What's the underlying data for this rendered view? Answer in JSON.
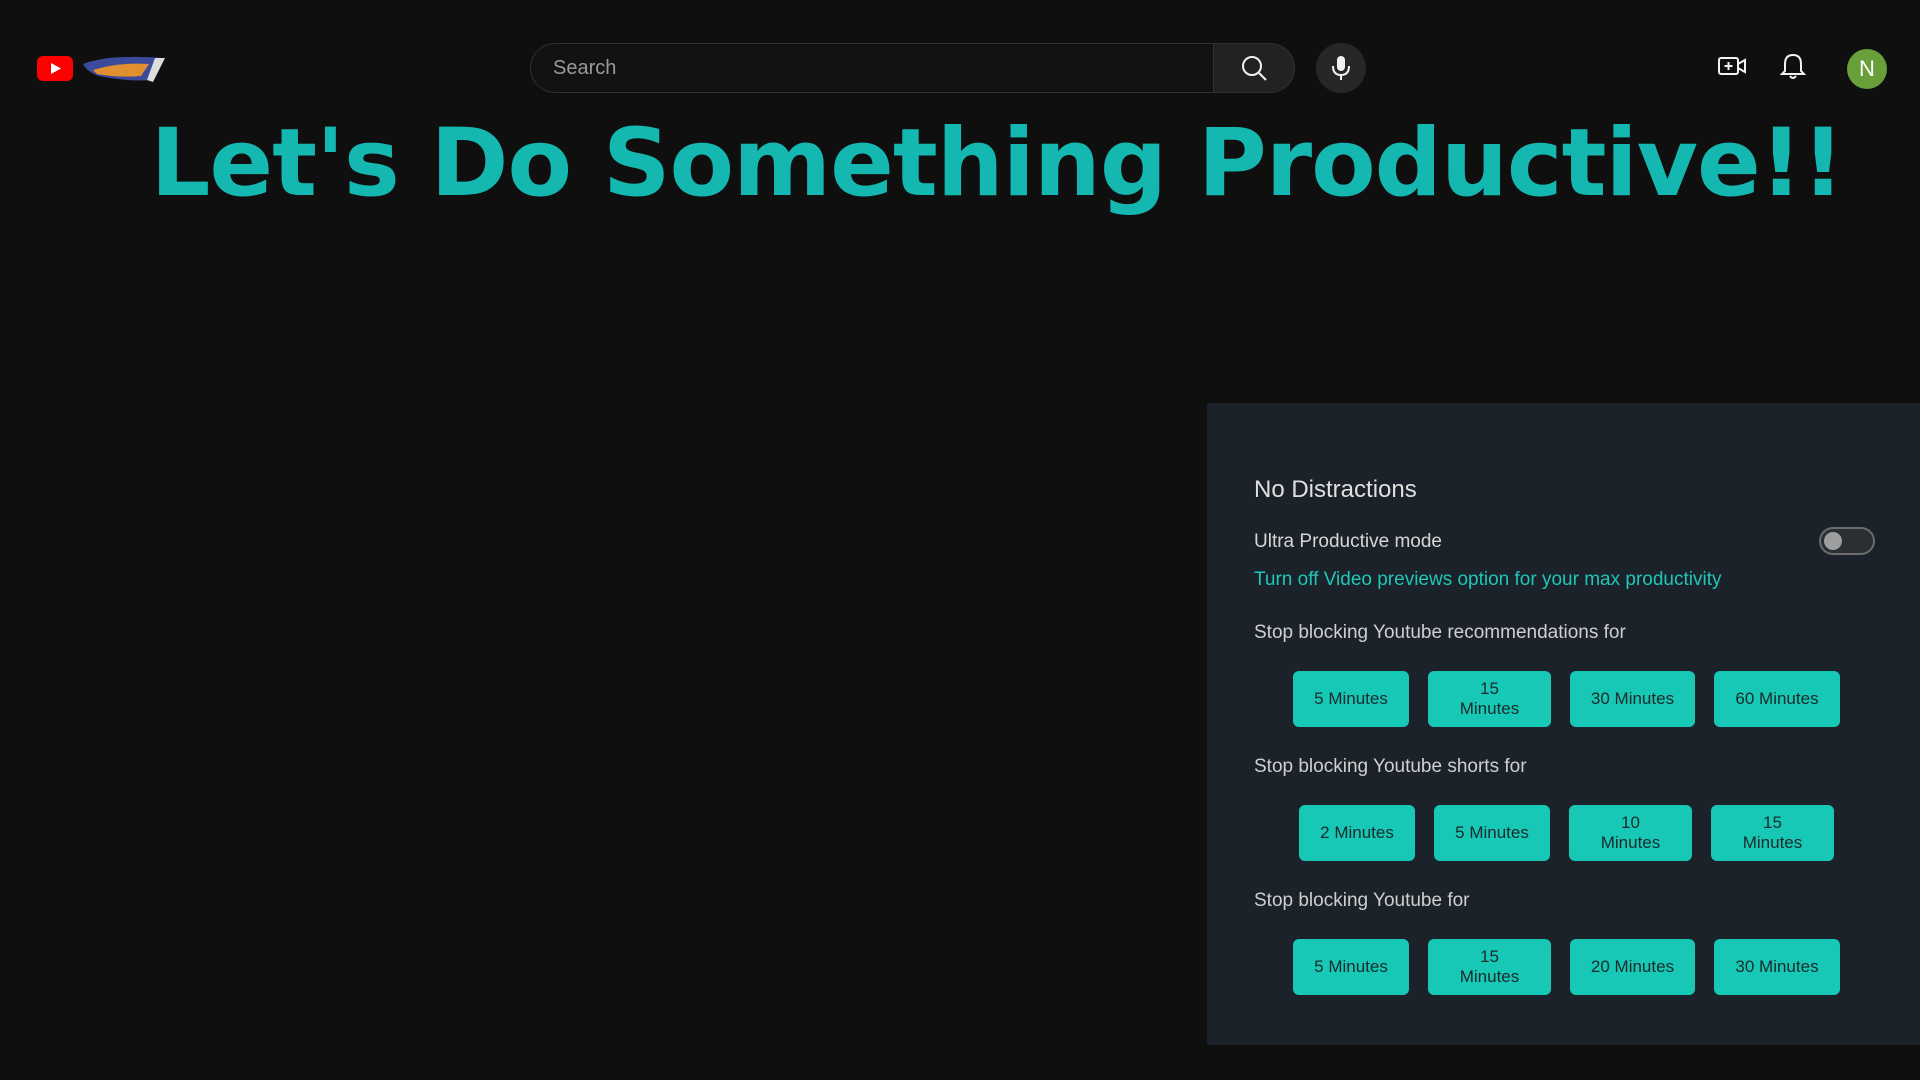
{
  "search": {
    "placeholder": "Search"
  },
  "avatar": {
    "initial": "N",
    "color": "#689f38"
  },
  "headline": "Let's Do Something Productive!!",
  "panel": {
    "title": "No Distractions",
    "ultra_mode": {
      "label": "Ultra Productive mode",
      "enabled": false
    },
    "tip": "Turn off Video previews option for your max productivity",
    "sections": [
      {
        "label": "Stop blocking Youtube recommendations for",
        "buttons": [
          "5 Minutes",
          "15 Minutes",
          "30 Minutes",
          "60 Minutes"
        ]
      },
      {
        "label": "Stop blocking Youtube shorts for",
        "buttons": [
          "2 Minutes",
          "5 Minutes",
          "10 Minutes",
          "15 Minutes"
        ]
      },
      {
        "label": "Stop blocking Youtube for",
        "buttons": [
          "5 Minutes",
          "15 Minutes",
          "20 Minutes",
          "30 Minutes"
        ]
      }
    ]
  },
  "icons": {
    "logo": "youtube-logo-icon",
    "doodle": "doodle-logo-icon",
    "search": "search-icon",
    "mic": "microphone-icon",
    "create": "create-video-icon",
    "bell": "bell-icon"
  },
  "colors": {
    "accent": "#14b8b0",
    "button": "#17c8b6",
    "panel_bg": "#1b2229",
    "page_bg": "#0f0f0f"
  }
}
